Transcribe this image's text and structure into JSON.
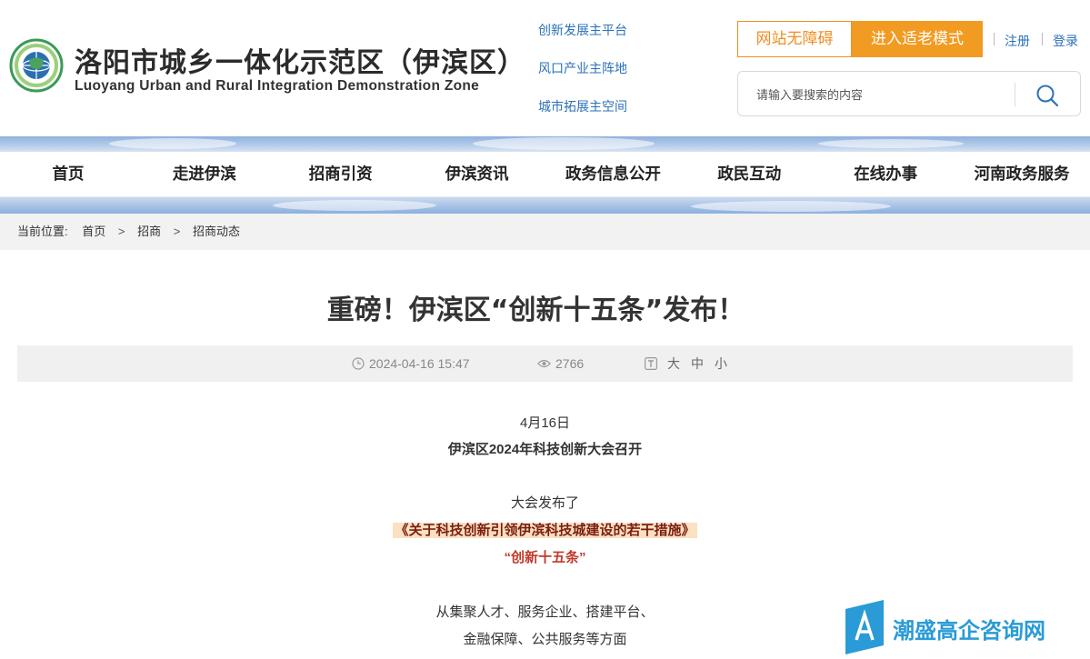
{
  "header": {
    "title": "洛阳市城乡一体化示范区（伊滨区）",
    "subtitle": "Luoyang Urban and Rural Integration Demonstration Zone",
    "quick_links": [
      "创新发展主平台",
      "风口产业主阵地",
      "城市拓展主空间"
    ],
    "accessibility_label": "网站无障碍",
    "elder_mode_label": "进入适老模式",
    "register_label": "注册",
    "login_label": "登录",
    "search_placeholder": "请输入要搜索的内容",
    "accent_color": "#f29b22",
    "link_color": "#2b72b8"
  },
  "nav": {
    "items": [
      "首页",
      "走进伊滨",
      "招商引资",
      "伊滨资讯",
      "政务信息公开",
      "政民互动",
      "在线办事",
      "河南政务服务"
    ]
  },
  "breadcrumb": {
    "label": "当前位置:",
    "items": [
      "首页",
      "招商",
      "招商动态"
    ]
  },
  "article": {
    "title": "重磅！伊滨区“创新十五条”发布！",
    "datetime": "2024-04-16 15:47",
    "views": "2766",
    "font_sizes": [
      "大",
      "中",
      "小"
    ],
    "paragraphs": {
      "p1": "4月16日",
      "p2": "伊滨区2024年科技创新大会召开",
      "p3": "大会发布了",
      "p4": "《关于科技创新引领伊滨科技城建设的若干措施》",
      "p5": "“创新十五条”",
      "p6": "从集聚人才、服务企业、搭建平台、",
      "p7": "金融保障、公共服务等方面"
    }
  },
  "watermark": {
    "text": "潮盛高企咨询网",
    "icon": "a-letter-icon"
  }
}
